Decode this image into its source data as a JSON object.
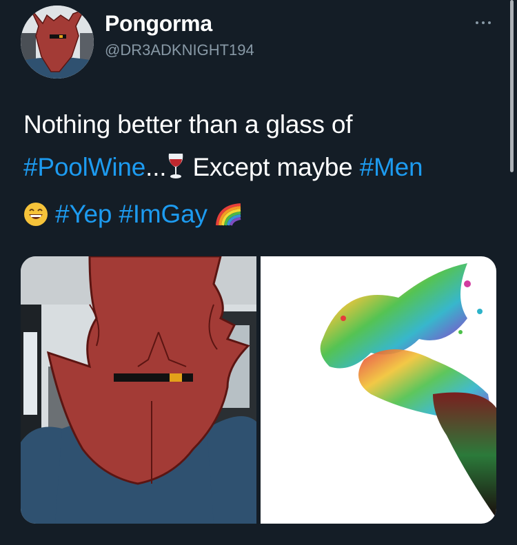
{
  "tweet": {
    "display_name": "Pongorma",
    "handle": "@DR3ADKNIGHT194",
    "more_icon": "more-horizontal-icon",
    "text_line1": "Nothing better than a glass of",
    "hashtag_poolwine": "#PoolWine",
    "ellipsis": "...",
    "text_except": " Except maybe ",
    "hashtag_men": "#Men",
    "hashtag_yep": "#Yep",
    "hashtag_imgay": "#ImGay",
    "emoji_wine": "wine-glass-emoji",
    "emoji_smile": "smiling-face-emoji",
    "emoji_rainbow": "rainbow-emoji"
  },
  "colors": {
    "background": "#141d26",
    "text": "#ffffff",
    "handle": "#8899a6",
    "hashtag": "#1d9bf0",
    "devil_red": "#a33b36",
    "fur_blue": "#2f5170"
  },
  "media": {
    "left_image": "red horned creature drawn over a photo inside a car",
    "right_image": "rainbow liquid splashing out of a wine glass"
  }
}
